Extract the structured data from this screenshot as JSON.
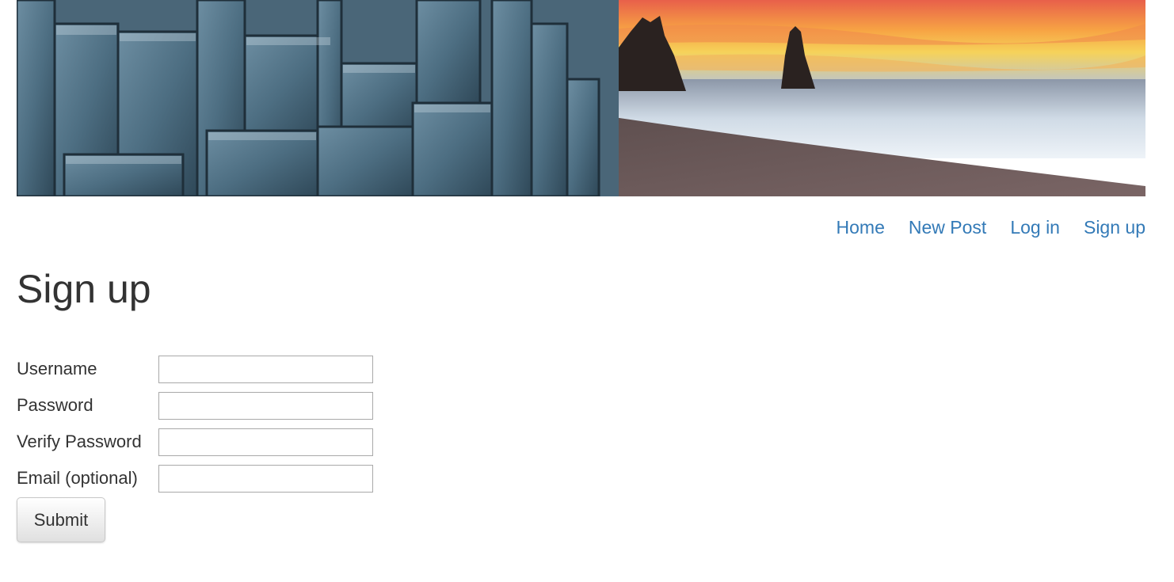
{
  "nav": {
    "items": [
      {
        "label": "Home"
      },
      {
        "label": "New Post"
      },
      {
        "label": "Log in"
      },
      {
        "label": "Sign up"
      }
    ],
    "link_color": "#337ab7"
  },
  "page": {
    "title": "Sign up"
  },
  "form": {
    "username_label": "Username",
    "username_value": "",
    "password_label": "Password",
    "password_value": "",
    "verify_label": "Verify Password",
    "verify_value": "",
    "email_label": "Email (optional)",
    "email_value": "",
    "submit_label": "Submit"
  },
  "banner": {
    "description_icon": "banner-image"
  }
}
